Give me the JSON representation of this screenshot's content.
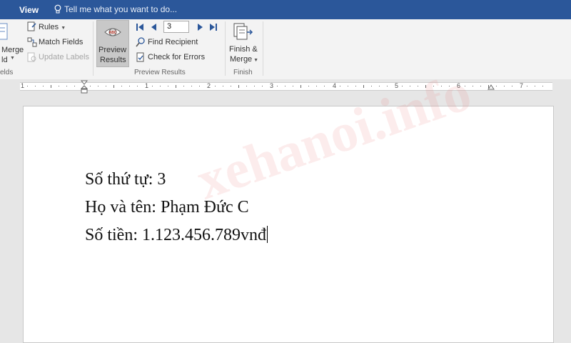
{
  "menubar": {
    "view_tab": "View",
    "tell_me": "Tell me what you want to do..."
  },
  "ribbon": {
    "write_insert": {
      "merge_field_line1": "Merge",
      "merge_field_line2": "ld",
      "group_label": "elds"
    },
    "rules_label": "Rules",
    "match_fields_label": "Match Fields",
    "update_labels_label": "Update Labels",
    "preview_results": {
      "button_line1": "Preview",
      "button_line2": "Results",
      "record_number": "3",
      "find_recipient_label": "Find Recipient",
      "check_errors_label": "Check for Errors",
      "group_label": "Preview Results"
    },
    "finish": {
      "button_line1": "Finish &",
      "button_line2": "Merge",
      "group_label": "Finish"
    }
  },
  "ruler": {
    "numbers": [
      "1",
      "1",
      "2",
      "3",
      "4",
      "5",
      "6",
      "7"
    ]
  },
  "document": {
    "line1": "Số thứ tự: 3",
    "line2": "Họ và tên: Phạm Đức C",
    "line3": "Số tiền: 1.123.456.789vnđ"
  },
  "watermark": "xehanoi.info",
  "colors": {
    "title_bar": "#2b579a",
    "ribbon_bg": "#f3f3f3",
    "nav_arrow": "#2b579a",
    "watermark": "#ec7878"
  }
}
